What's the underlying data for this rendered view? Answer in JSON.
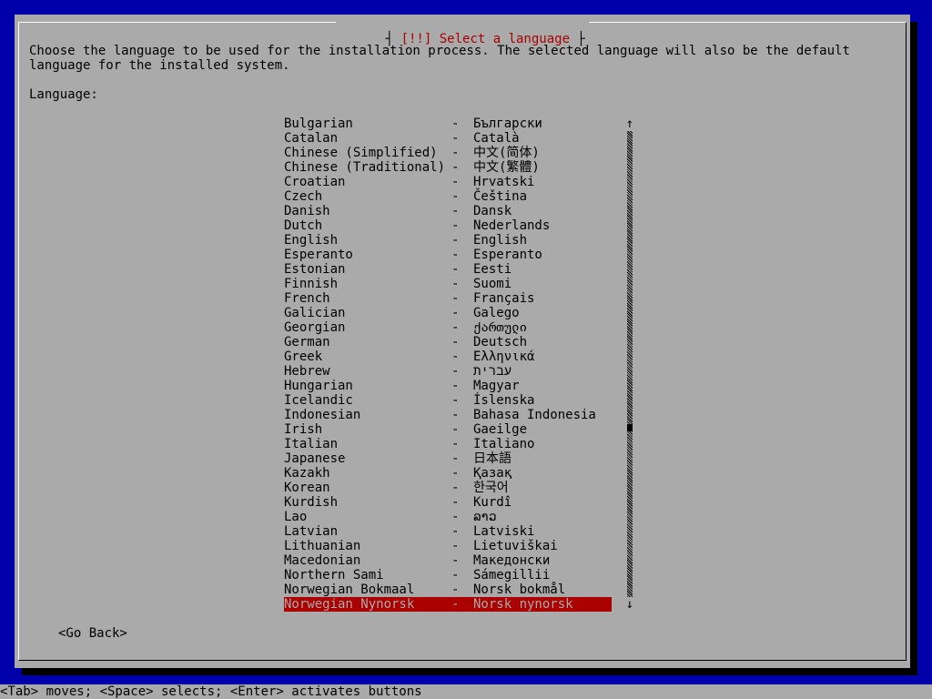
{
  "title": {
    "text": "[!!] Select a language"
  },
  "description": "Choose the language to be used for the installation process. The selected language will also be the default language for the installed system.",
  "list_label": "Language:",
  "languages": [
    {
      "name": "Bulgarian",
      "native": "Български"
    },
    {
      "name": "Catalan",
      "native": "Català"
    },
    {
      "name": "Chinese (Simplified)",
      "native": "中文(简体)"
    },
    {
      "name": "Chinese (Traditional)",
      "native": "中文(繁體)"
    },
    {
      "name": "Croatian",
      "native": "Hrvatski"
    },
    {
      "name": "Czech",
      "native": "Čeština"
    },
    {
      "name": "Danish",
      "native": "Dansk"
    },
    {
      "name": "Dutch",
      "native": "Nederlands"
    },
    {
      "name": "English",
      "native": "English"
    },
    {
      "name": "Esperanto",
      "native": "Esperanto"
    },
    {
      "name": "Estonian",
      "native": "Eesti"
    },
    {
      "name": "Finnish",
      "native": "Suomi"
    },
    {
      "name": "French",
      "native": "Français"
    },
    {
      "name": "Galician",
      "native": "Galego"
    },
    {
      "name": "Georgian",
      "native": "ქართული"
    },
    {
      "name": "German",
      "native": "Deutsch"
    },
    {
      "name": "Greek",
      "native": "Ελληνικά"
    },
    {
      "name": "Hebrew",
      "native": "עברית"
    },
    {
      "name": "Hungarian",
      "native": "Magyar"
    },
    {
      "name": "Icelandic",
      "native": "Íslenska"
    },
    {
      "name": "Indonesian",
      "native": "Bahasa Indonesia"
    },
    {
      "name": "Irish",
      "native": "Gaeilge"
    },
    {
      "name": "Italian",
      "native": "Italiano"
    },
    {
      "name": "Japanese",
      "native": "日本語"
    },
    {
      "name": "Kazakh",
      "native": "Қазақ"
    },
    {
      "name": "Korean",
      "native": "한국어"
    },
    {
      "name": "Kurdish",
      "native": "Kurdî"
    },
    {
      "name": "Lao",
      "native": "ລາວ"
    },
    {
      "name": "Latvian",
      "native": "Latviski"
    },
    {
      "name": "Lithuanian",
      "native": "Lietuviškai"
    },
    {
      "name": "Macedonian",
      "native": "Македонски"
    },
    {
      "name": "Northern Sami",
      "native": "Sámegillii"
    },
    {
      "name": "Norwegian Bokmaal",
      "native": "Norsk bokmål"
    },
    {
      "name": "Norwegian Nynorsk",
      "native": "Norsk nynorsk",
      "selected": true
    }
  ],
  "scrollbar": {
    "up_arrow": "↑",
    "down_arrow": "↓"
  },
  "go_back_label": "<Go Back>",
  "status_bar": "<Tab> moves; <Space> selects; <Enter> activates buttons",
  "colors": {
    "background": "#0000aa",
    "dialog": "#aaaaaa",
    "title": "#aa0000",
    "selection": "#aa0000"
  }
}
